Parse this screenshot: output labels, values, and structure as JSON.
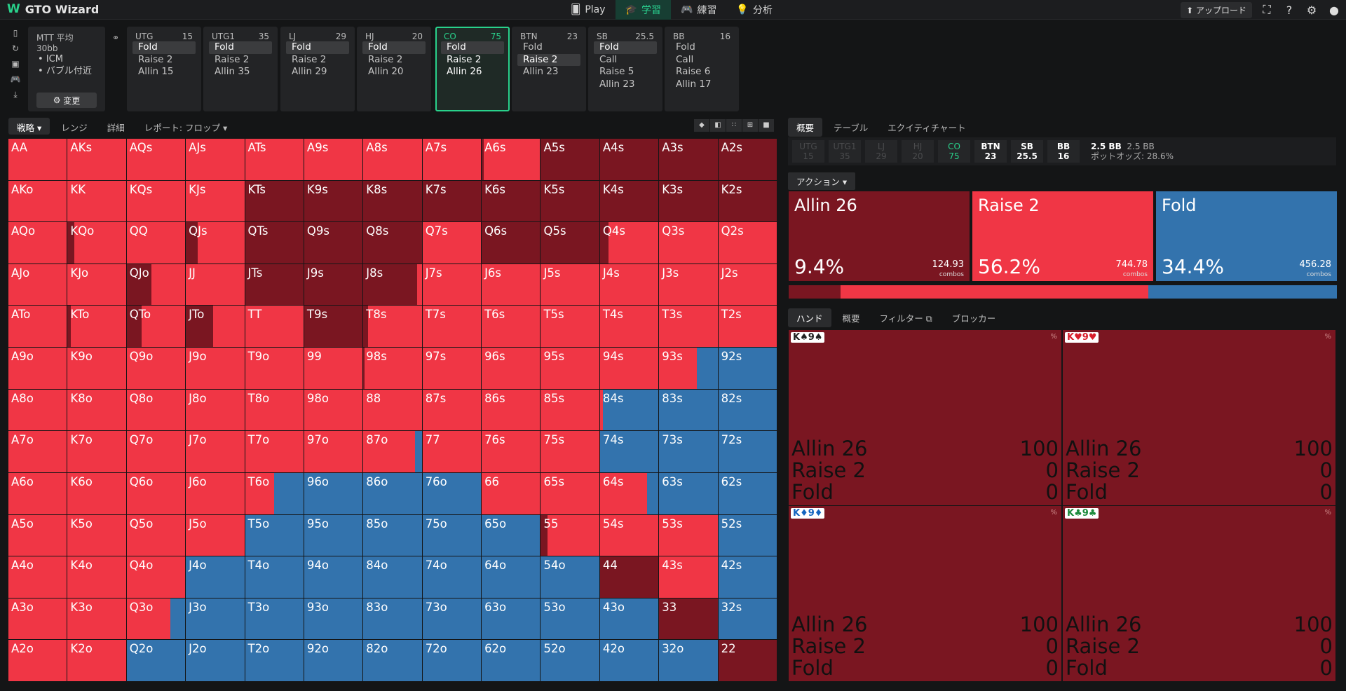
{
  "app": {
    "title": "GTO Wizard",
    "nav": [
      {
        "label": "Play",
        "icon": "cards-icon"
      },
      {
        "label": "学習",
        "icon": "grad-cap-icon",
        "active": true
      },
      {
        "label": "練習",
        "icon": "gamepad-icon"
      },
      {
        "label": "分析",
        "icon": "lightbulb-icon"
      }
    ],
    "upload_label": "アップロード"
  },
  "mtt": {
    "title": "MTT 平均 30bb",
    "bullets": [
      "ICM",
      "バブル付近"
    ],
    "change_label": "変更"
  },
  "positions": [
    {
      "name": "UTG",
      "stack": "15",
      "actions": [
        "Fold",
        "Raise 2",
        "Allin 15"
      ],
      "selected": 0
    },
    {
      "name": "UTG1",
      "stack": "35",
      "actions": [
        "Fold",
        "Raise 2",
        "Allin 35"
      ],
      "selected": 0
    },
    {
      "name": "LJ",
      "stack": "29",
      "actions": [
        "Fold",
        "Raise 2",
        "Allin 29"
      ],
      "selected": 0
    },
    {
      "name": "HJ",
      "stack": "20",
      "actions": [
        "Fold",
        "Raise 2",
        "Allin 20"
      ],
      "selected": 0
    },
    {
      "name": "CO",
      "stack": "75",
      "actions": [
        "Fold",
        "Raise 2",
        "Allin 26"
      ],
      "selected": 0,
      "active": true
    },
    {
      "name": "BTN",
      "stack": "23",
      "actions": [
        "Fold",
        "Raise 2",
        "Allin 23"
      ],
      "selected": 1
    },
    {
      "name": "SB",
      "stack": "25.5",
      "actions": [
        "Fold",
        "Call",
        "Raise 5",
        "Allin 23"
      ],
      "selected": 0
    },
    {
      "name": "BB",
      "stack": "16",
      "actions": [
        "Fold",
        "Call",
        "Raise 6",
        "Allin 17"
      ],
      "selected": -1
    }
  ],
  "strategy_tabs": [
    "戦略",
    "レンジ",
    "詳細",
    "レポート: フロップ"
  ],
  "right_tabs": [
    "概要",
    "テーブル",
    "エクイティチャート"
  ],
  "pot_positions": [
    {
      "n": "UTG",
      "s": "15",
      "st": "dim"
    },
    {
      "n": "UTG1",
      "s": "35",
      "st": "dim"
    },
    {
      "n": "LJ",
      "s": "29",
      "st": "dim"
    },
    {
      "n": "HJ",
      "s": "20",
      "st": "dim"
    },
    {
      "n": "CO",
      "s": "75",
      "st": "cur"
    },
    {
      "n": "BTN",
      "s": "23",
      "st": "on"
    },
    {
      "n": "SB",
      "s": "25.5",
      "st": "on"
    },
    {
      "n": "BB",
      "s": "16",
      "st": "on"
    }
  ],
  "pot": {
    "bb": "2.5 BB",
    "bb2": "2.5 BB",
    "odds_label": "ポットオッズ:",
    "odds": "28.6%"
  },
  "action_dropdown": "アクション",
  "actions": [
    {
      "name": "Allin 26",
      "pct": "9.4%",
      "combos": "124.93",
      "color": "#7a1621"
    },
    {
      "name": "Raise 2",
      "pct": "56.2%",
      "combos": "744.78",
      "color": "#f03645"
    },
    {
      "name": "Fold",
      "pct": "34.4%",
      "combos": "456.28",
      "color": "#3373ad"
    }
  ],
  "combos_label": "combos",
  "hand_tabs": [
    "ハンド",
    "概要",
    "フィルター",
    "ブロッカー"
  ],
  "selected_combos": [
    {
      "label": "K♠9♠",
      "color": "#222"
    },
    {
      "label": "K♥9♥",
      "color": "#d81e2c"
    },
    {
      "label": "K♦9♦",
      "color": "#1565c0"
    },
    {
      "label": "K♣9♣",
      "color": "#1b8a3b"
    }
  ],
  "combo_rows": [
    {
      "name": "Allin 26",
      "val": "100"
    },
    {
      "name": "Raise 2",
      "val": "0"
    },
    {
      "name": "Fold",
      "val": "0"
    }
  ],
  "combo_pct_label": "%",
  "colors": {
    "allin": "#7a1621",
    "raise": "#f03645",
    "fold": "#3373ad"
  },
  "hands": [
    [
      "AA",
      "AKs",
      "AQs",
      "AJs",
      "ATs",
      "A9s",
      "A8s",
      "A7s",
      "A6s",
      "A5s",
      "A4s",
      "A3s",
      "A2s"
    ],
    [
      "AKo",
      "KK",
      "KQs",
      "KJs",
      "KTs",
      "K9s",
      "K8s",
      "K7s",
      "K6s",
      "K5s",
      "K4s",
      "K3s",
      "K2s"
    ],
    [
      "AQo",
      "KQo",
      "QQ",
      "QJs",
      "QTs",
      "Q9s",
      "Q8s",
      "Q7s",
      "Q6s",
      "Q5s",
      "Q4s",
      "Q3s",
      "Q2s"
    ],
    [
      "AJo",
      "KJo",
      "QJo",
      "JJ",
      "JTs",
      "J9s",
      "J8s",
      "J7s",
      "J6s",
      "J5s",
      "J4s",
      "J3s",
      "J2s"
    ],
    [
      "ATo",
      "KTo",
      "QTo",
      "JTo",
      "TT",
      "T9s",
      "T8s",
      "T7s",
      "T6s",
      "T5s",
      "T4s",
      "T3s",
      "T2s"
    ],
    [
      "A9o",
      "K9o",
      "Q9o",
      "J9o",
      "T9o",
      "99",
      "98s",
      "97s",
      "96s",
      "95s",
      "94s",
      "93s",
      "92s"
    ],
    [
      "A8o",
      "K8o",
      "Q8o",
      "J8o",
      "T8o",
      "98o",
      "88",
      "87s",
      "86s",
      "85s",
      "84s",
      "83s",
      "82s"
    ],
    [
      "A7o",
      "K7o",
      "Q7o",
      "J7o",
      "T7o",
      "97o",
      "87o",
      "77",
      "76s",
      "75s",
      "74s",
      "73s",
      "72s"
    ],
    [
      "A6o",
      "K6o",
      "Q6o",
      "J6o",
      "T6o",
      "96o",
      "86o",
      "76o",
      "66",
      "65s",
      "64s",
      "63s",
      "62s"
    ],
    [
      "A5o",
      "K5o",
      "Q5o",
      "J5o",
      "T5o",
      "95o",
      "85o",
      "75o",
      "65o",
      "55",
      "54s",
      "53s",
      "52s"
    ],
    [
      "A4o",
      "K4o",
      "Q4o",
      "J4o",
      "T4o",
      "94o",
      "84o",
      "74o",
      "64o",
      "54o",
      "44",
      "43s",
      "42s"
    ],
    [
      "A3o",
      "K3o",
      "Q3o",
      "J3o",
      "T3o",
      "93o",
      "83o",
      "73o",
      "63o",
      "53o",
      "43o",
      "33",
      "32s"
    ],
    [
      "A2o",
      "K2o",
      "Q2o",
      "J2o",
      "T2o",
      "92o",
      "82o",
      "72o",
      "62o",
      "52o",
      "42o",
      "32o",
      "22"
    ]
  ],
  "freqs": [
    [
      [
        0,
        1,
        0
      ],
      [
        0,
        1,
        0
      ],
      [
        0,
        1,
        0
      ],
      [
        0,
        1,
        0
      ],
      [
        0,
        1,
        0
      ],
      [
        0,
        1,
        0
      ],
      [
        0,
        1,
        0
      ],
      [
        0,
        1,
        0
      ],
      [
        0.03,
        0.97,
        0
      ],
      [
        1,
        0,
        0
      ],
      [
        1,
        0,
        0
      ],
      [
        1,
        0,
        0
      ],
      [
        1,
        0,
        0
      ]
    ],
    [
      [
        0,
        1,
        0
      ],
      [
        0,
        1,
        0
      ],
      [
        0,
        1,
        0
      ],
      [
        0,
        1,
        0
      ],
      [
        1,
        0,
        0
      ],
      [
        1,
        0,
        0
      ],
      [
        1,
        0,
        0
      ],
      [
        1,
        0,
        0
      ],
      [
        1,
        0,
        0
      ],
      [
        1,
        0,
        0
      ],
      [
        1,
        0,
        0
      ],
      [
        1,
        0,
        0
      ],
      [
        1,
        0,
        0
      ]
    ],
    [
      [
        0,
        1,
        0
      ],
      [
        0.12,
        0.88,
        0
      ],
      [
        0,
        1,
        0
      ],
      [
        0.2,
        0.8,
        0
      ],
      [
        1,
        0,
        0
      ],
      [
        1,
        0,
        0
      ],
      [
        1,
        0,
        0
      ],
      [
        0,
        1,
        0
      ],
      [
        1,
        0,
        0
      ],
      [
        1,
        0,
        0
      ],
      [
        0.15,
        0.85,
        0
      ],
      [
        0,
        1,
        0
      ],
      [
        0,
        1,
        0
      ]
    ],
    [
      [
        0,
        1,
        0
      ],
      [
        0,
        1,
        0
      ],
      [
        0.42,
        0.58,
        0
      ],
      [
        0,
        1,
        0
      ],
      [
        1,
        0,
        0
      ],
      [
        1,
        0,
        0
      ],
      [
        0.92,
        0.08,
        0
      ],
      [
        0,
        1,
        0
      ],
      [
        0,
        1,
        0
      ],
      [
        0,
        1,
        0
      ],
      [
        0,
        1,
        0
      ],
      [
        0,
        1,
        0
      ],
      [
        0,
        1,
        0
      ]
    ],
    [
      [
        0,
        1,
        0
      ],
      [
        0.05,
        0.95,
        0
      ],
      [
        0.25,
        0.75,
        0
      ],
      [
        0.47,
        0.53,
        0
      ],
      [
        0,
        1,
        0
      ],
      [
        1,
        0,
        0
      ],
      [
        0.08,
        0.92,
        0
      ],
      [
        0,
        1,
        0
      ],
      [
        0,
        1,
        0
      ],
      [
        0,
        1,
        0
      ],
      [
        0,
        1,
        0
      ],
      [
        0,
        1,
        0
      ],
      [
        0,
        1,
        0
      ]
    ],
    [
      [
        0,
        1,
        0
      ],
      [
        0,
        1,
        0
      ],
      [
        0,
        1,
        0
      ],
      [
        0,
        1,
        0
      ],
      [
        0,
        1,
        0
      ],
      [
        0,
        1,
        0
      ],
      [
        0.02,
        0.98,
        0
      ],
      [
        0,
        1,
        0
      ],
      [
        0,
        1,
        0
      ],
      [
        0,
        1,
        0
      ],
      [
        0,
        1,
        0
      ],
      [
        0,
        0.65,
        0.35
      ],
      [
        0,
        0,
        1
      ]
    ],
    [
      [
        0,
        1,
        0
      ],
      [
        0,
        1,
        0
      ],
      [
        0,
        1,
        0
      ],
      [
        0,
        1,
        0
      ],
      [
        0,
        1,
        0
      ],
      [
        0,
        1,
        0
      ],
      [
        0,
        1,
        0
      ],
      [
        0,
        1,
        0
      ],
      [
        0,
        1,
        0
      ],
      [
        0,
        1,
        0
      ],
      [
        0,
        0.05,
        0.95
      ],
      [
        0,
        0,
        1
      ],
      [
        0,
        0,
        1
      ]
    ],
    [
      [
        0,
        1,
        0
      ],
      [
        0,
        1,
        0
      ],
      [
        0,
        1,
        0
      ],
      [
        0,
        1,
        0
      ],
      [
        0,
        1,
        0
      ],
      [
        0,
        1,
        0
      ],
      [
        0,
        0.88,
        0.12
      ],
      [
        0,
        1,
        0
      ],
      [
        0,
        1,
        0
      ],
      [
        0,
        1,
        0
      ],
      [
        0,
        0,
        1
      ],
      [
        0,
        0,
        1
      ],
      [
        0,
        0,
        1
      ]
    ],
    [
      [
        0,
        1,
        0
      ],
      [
        0,
        1,
        0
      ],
      [
        0,
        1,
        0
      ],
      [
        0,
        1,
        0
      ],
      [
        0,
        0.5,
        0.5
      ],
      [
        0,
        0,
        1
      ],
      [
        0,
        0,
        1
      ],
      [
        0,
        0,
        1
      ],
      [
        0,
        1,
        0
      ],
      [
        0,
        1,
        0
      ],
      [
        0,
        0.8,
        0.2
      ],
      [
        0,
        0,
        1
      ],
      [
        0,
        0,
        1
      ]
    ],
    [
      [
        0,
        1,
        0
      ],
      [
        0,
        1,
        0
      ],
      [
        0,
        1,
        0
      ],
      [
        0,
        1,
        0
      ],
      [
        0,
        0,
        1
      ],
      [
        0,
        0,
        1
      ],
      [
        0,
        0,
        1
      ],
      [
        0,
        0,
        1
      ],
      [
        0,
        0,
        1
      ],
      [
        0.12,
        0.88,
        0
      ],
      [
        0,
        1,
        0
      ],
      [
        0,
        1,
        0
      ],
      [
        0,
        0,
        1
      ]
    ],
    [
      [
        0,
        1,
        0
      ],
      [
        0,
        1,
        0
      ],
      [
        0,
        1,
        0
      ],
      [
        0,
        0,
        1
      ],
      [
        0,
        0,
        1
      ],
      [
        0,
        0,
        1
      ],
      [
        0,
        0,
        1
      ],
      [
        0,
        0,
        1
      ],
      [
        0,
        0,
        1
      ],
      [
        0,
        0,
        1
      ],
      [
        1,
        0,
        0
      ],
      [
        0,
        1,
        0
      ],
      [
        0,
        0,
        1
      ]
    ],
    [
      [
        0,
        1,
        0
      ],
      [
        0,
        1,
        0
      ],
      [
        0,
        0.75,
        0.25
      ],
      [
        0,
        0,
        1
      ],
      [
        0,
        0,
        1
      ],
      [
        0,
        0,
        1
      ],
      [
        0,
        0,
        1
      ],
      [
        0,
        0,
        1
      ],
      [
        0,
        0,
        1
      ],
      [
        0,
        0,
        1
      ],
      [
        0,
        0,
        1
      ],
      [
        1,
        0,
        0
      ],
      [
        0,
        0,
        1
      ]
    ],
    [
      [
        0,
        1,
        0
      ],
      [
        0,
        1,
        0
      ],
      [
        0,
        0,
        1
      ],
      [
        0,
        0,
        1
      ],
      [
        0,
        0,
        1
      ],
      [
        0,
        0,
        1
      ],
      [
        0,
        0,
        1
      ],
      [
        0,
        0,
        1
      ],
      [
        0,
        0,
        1
      ],
      [
        0,
        0,
        1
      ],
      [
        0,
        0,
        1
      ],
      [
        0,
        0,
        1
      ],
      [
        1,
        0,
        0
      ]
    ]
  ]
}
